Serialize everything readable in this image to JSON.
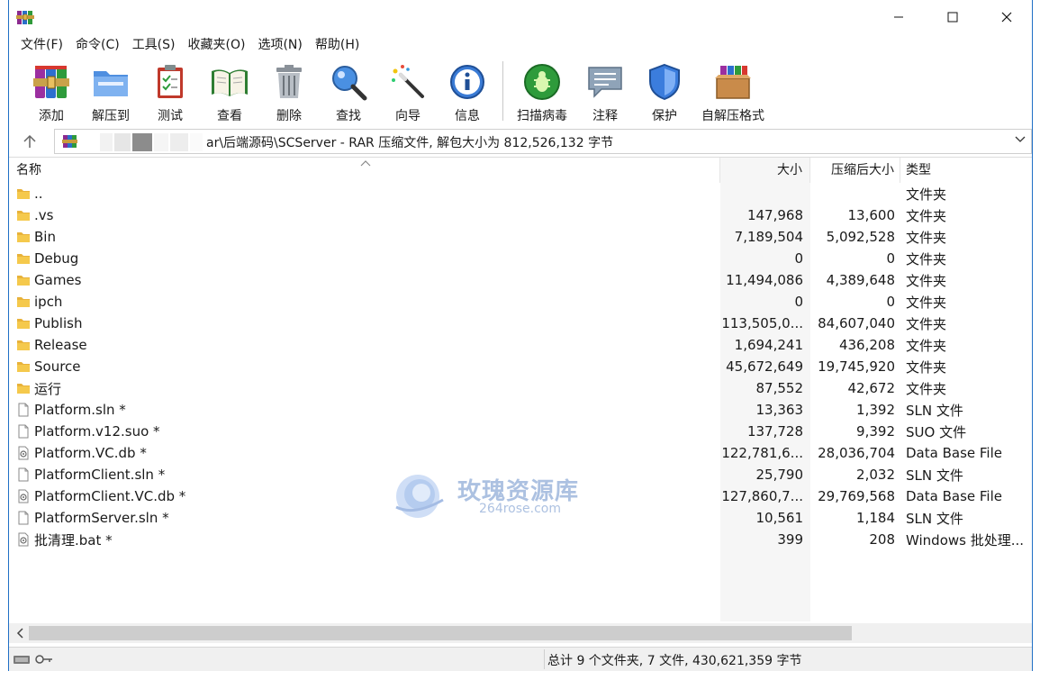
{
  "menu": [
    "文件(F)",
    "命令(C)",
    "工具(S)",
    "收藏夹(O)",
    "选项(N)",
    "帮助(H)"
  ],
  "toolbar": {
    "add": "添加",
    "extract": "解压到",
    "test": "测试",
    "view": "查看",
    "delete": "删除",
    "find": "查找",
    "wizard": "向导",
    "info": "信息",
    "scan": "扫描病毒",
    "comment": "注释",
    "protect": "保护",
    "sfx": "自解压格式"
  },
  "address": {
    "text": "ar\\后端源码\\SCServer - RAR 压缩文件, 解包大小为 812,526,132 字节"
  },
  "columns": {
    "name": "名称",
    "size": "大小",
    "packed": "压缩后大小",
    "type": "类型"
  },
  "files": [
    {
      "name": "..",
      "size": "",
      "packed": "",
      "type": "文件夹",
      "kind": "folder"
    },
    {
      "name": ".vs",
      "size": "147,968",
      "packed": "13,600",
      "type": "文件夹",
      "kind": "folder"
    },
    {
      "name": "Bin",
      "size": "7,189,504",
      "packed": "5,092,528",
      "type": "文件夹",
      "kind": "folder"
    },
    {
      "name": "Debug",
      "size": "0",
      "packed": "0",
      "type": "文件夹",
      "kind": "folder"
    },
    {
      "name": "Games",
      "size": "11,494,086",
      "packed": "4,389,648",
      "type": "文件夹",
      "kind": "folder"
    },
    {
      "name": "ipch",
      "size": "0",
      "packed": "0",
      "type": "文件夹",
      "kind": "folder"
    },
    {
      "name": "Publish",
      "size": "113,505,0...",
      "packed": "84,607,040",
      "type": "文件夹",
      "kind": "folder"
    },
    {
      "name": "Release",
      "size": "1,694,241",
      "packed": "436,208",
      "type": "文件夹",
      "kind": "folder"
    },
    {
      "name": "Source",
      "size": "45,672,649",
      "packed": "19,745,920",
      "type": "文件夹",
      "kind": "folder"
    },
    {
      "name": "运行",
      "size": "87,552",
      "packed": "42,672",
      "type": "文件夹",
      "kind": "folder"
    },
    {
      "name": "Platform.sln *",
      "size": "13,363",
      "packed": "1,392",
      "type": "SLN 文件",
      "kind": "file"
    },
    {
      "name": "Platform.v12.suo *",
      "size": "137,728",
      "packed": "9,392",
      "type": "SUO 文件",
      "kind": "file"
    },
    {
      "name": "Platform.VC.db *",
      "size": "122,781,6...",
      "packed": "28,036,704",
      "type": "Data Base File",
      "kind": "db"
    },
    {
      "name": "PlatformClient.sln *",
      "size": "25,790",
      "packed": "2,032",
      "type": "SLN 文件",
      "kind": "file"
    },
    {
      "name": "PlatformClient.VC.db *",
      "size": "127,860,7...",
      "packed": "29,769,568",
      "type": "Data Base File",
      "kind": "db"
    },
    {
      "name": "PlatformServer.sln *",
      "size": "10,561",
      "packed": "1,184",
      "type": "SLN 文件",
      "kind": "file"
    },
    {
      "name": "批清理.bat *",
      "size": "399",
      "packed": "208",
      "type": "Windows 批处理...",
      "kind": "db"
    }
  ],
  "watermark": {
    "title": "玫瑰资源库",
    "subtitle": "264rose.com"
  },
  "status": {
    "text": "总计 9 个文件夹, 7 文件, 430,621,359 字节"
  }
}
